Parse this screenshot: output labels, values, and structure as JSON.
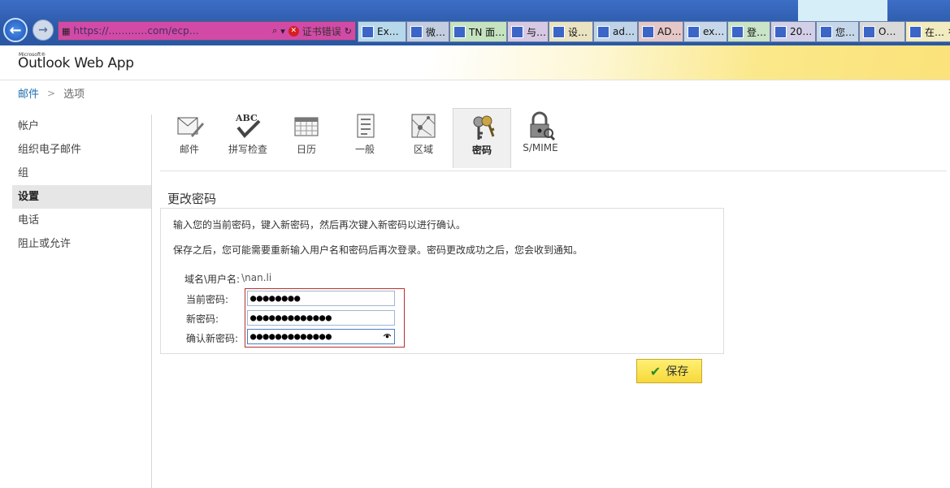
{
  "browser": {
    "url": "https://…………com/ecp…",
    "cert_error": "证书错误",
    "tabs": [
      {
        "label": "Ex…",
        "icon": "e-icon"
      },
      {
        "label": "微…",
        "icon": "paw-icon"
      },
      {
        "label": "TN 面…",
        "icon": "tn-icon"
      },
      {
        "label": "与…",
        "icon": "paw-icon"
      },
      {
        "label": "设…",
        "icon": "page-icon"
      },
      {
        "label": "ad…",
        "icon": "paw-icon"
      },
      {
        "label": "AD…",
        "icon": "c-icon"
      },
      {
        "label": "ex…",
        "icon": "paw-icon"
      },
      {
        "label": "登…",
        "icon": "in-icon"
      },
      {
        "label": "20…",
        "icon": "paw-icon"
      },
      {
        "label": "您…",
        "icon": "paw-icon"
      },
      {
        "label": "O…",
        "icon": "tn-icon"
      },
      {
        "label": "在…",
        "icon": "paw-icon"
      }
    ]
  },
  "app": {
    "brand_small": "Microsoft®",
    "brand": "Outlook Web App"
  },
  "breadcrumb": {
    "root": "邮件",
    "separator": ">",
    "current": "选项"
  },
  "left_nav": [
    {
      "label": "帐户",
      "active": false
    },
    {
      "label": "组织电子邮件",
      "active": false
    },
    {
      "label": "组",
      "active": false
    },
    {
      "label": "设置",
      "active": true
    },
    {
      "label": "电话",
      "active": false
    },
    {
      "label": "阻止或允许",
      "active": false
    }
  ],
  "toolbar": [
    {
      "label": "邮件",
      "icon": "mail-settings-icon"
    },
    {
      "label": "拼写检查",
      "icon": "spellcheck-icon"
    },
    {
      "label": "日历",
      "icon": "calendar-icon"
    },
    {
      "label": "一般",
      "icon": "general-icon"
    },
    {
      "label": "区域",
      "icon": "region-icon"
    },
    {
      "label": "密码",
      "icon": "keys-icon",
      "active": true
    },
    {
      "label": "S/MIME",
      "icon": "smime-lock-icon"
    }
  ],
  "form": {
    "title": "更改密码",
    "info1": "输入您的当前密码，键入新密码，然后再次键入新密码以进行确认。",
    "info2": "保存之后，您可能需要重新输入用户名和密码后再次登录。密码更改成功之后，您会收到通知。",
    "domain_label": "域名\\用户名:",
    "domain_value": "\\nan.li",
    "current_label": "当前密码:",
    "current_value": "●●●●●●●●",
    "new_label": "新密码:",
    "new_value": "●●●●●●●●●●●●●",
    "confirm_label": "确认新密码:",
    "confirm_value": "●●●●●●●●●●●●●",
    "save_label": "保存"
  }
}
